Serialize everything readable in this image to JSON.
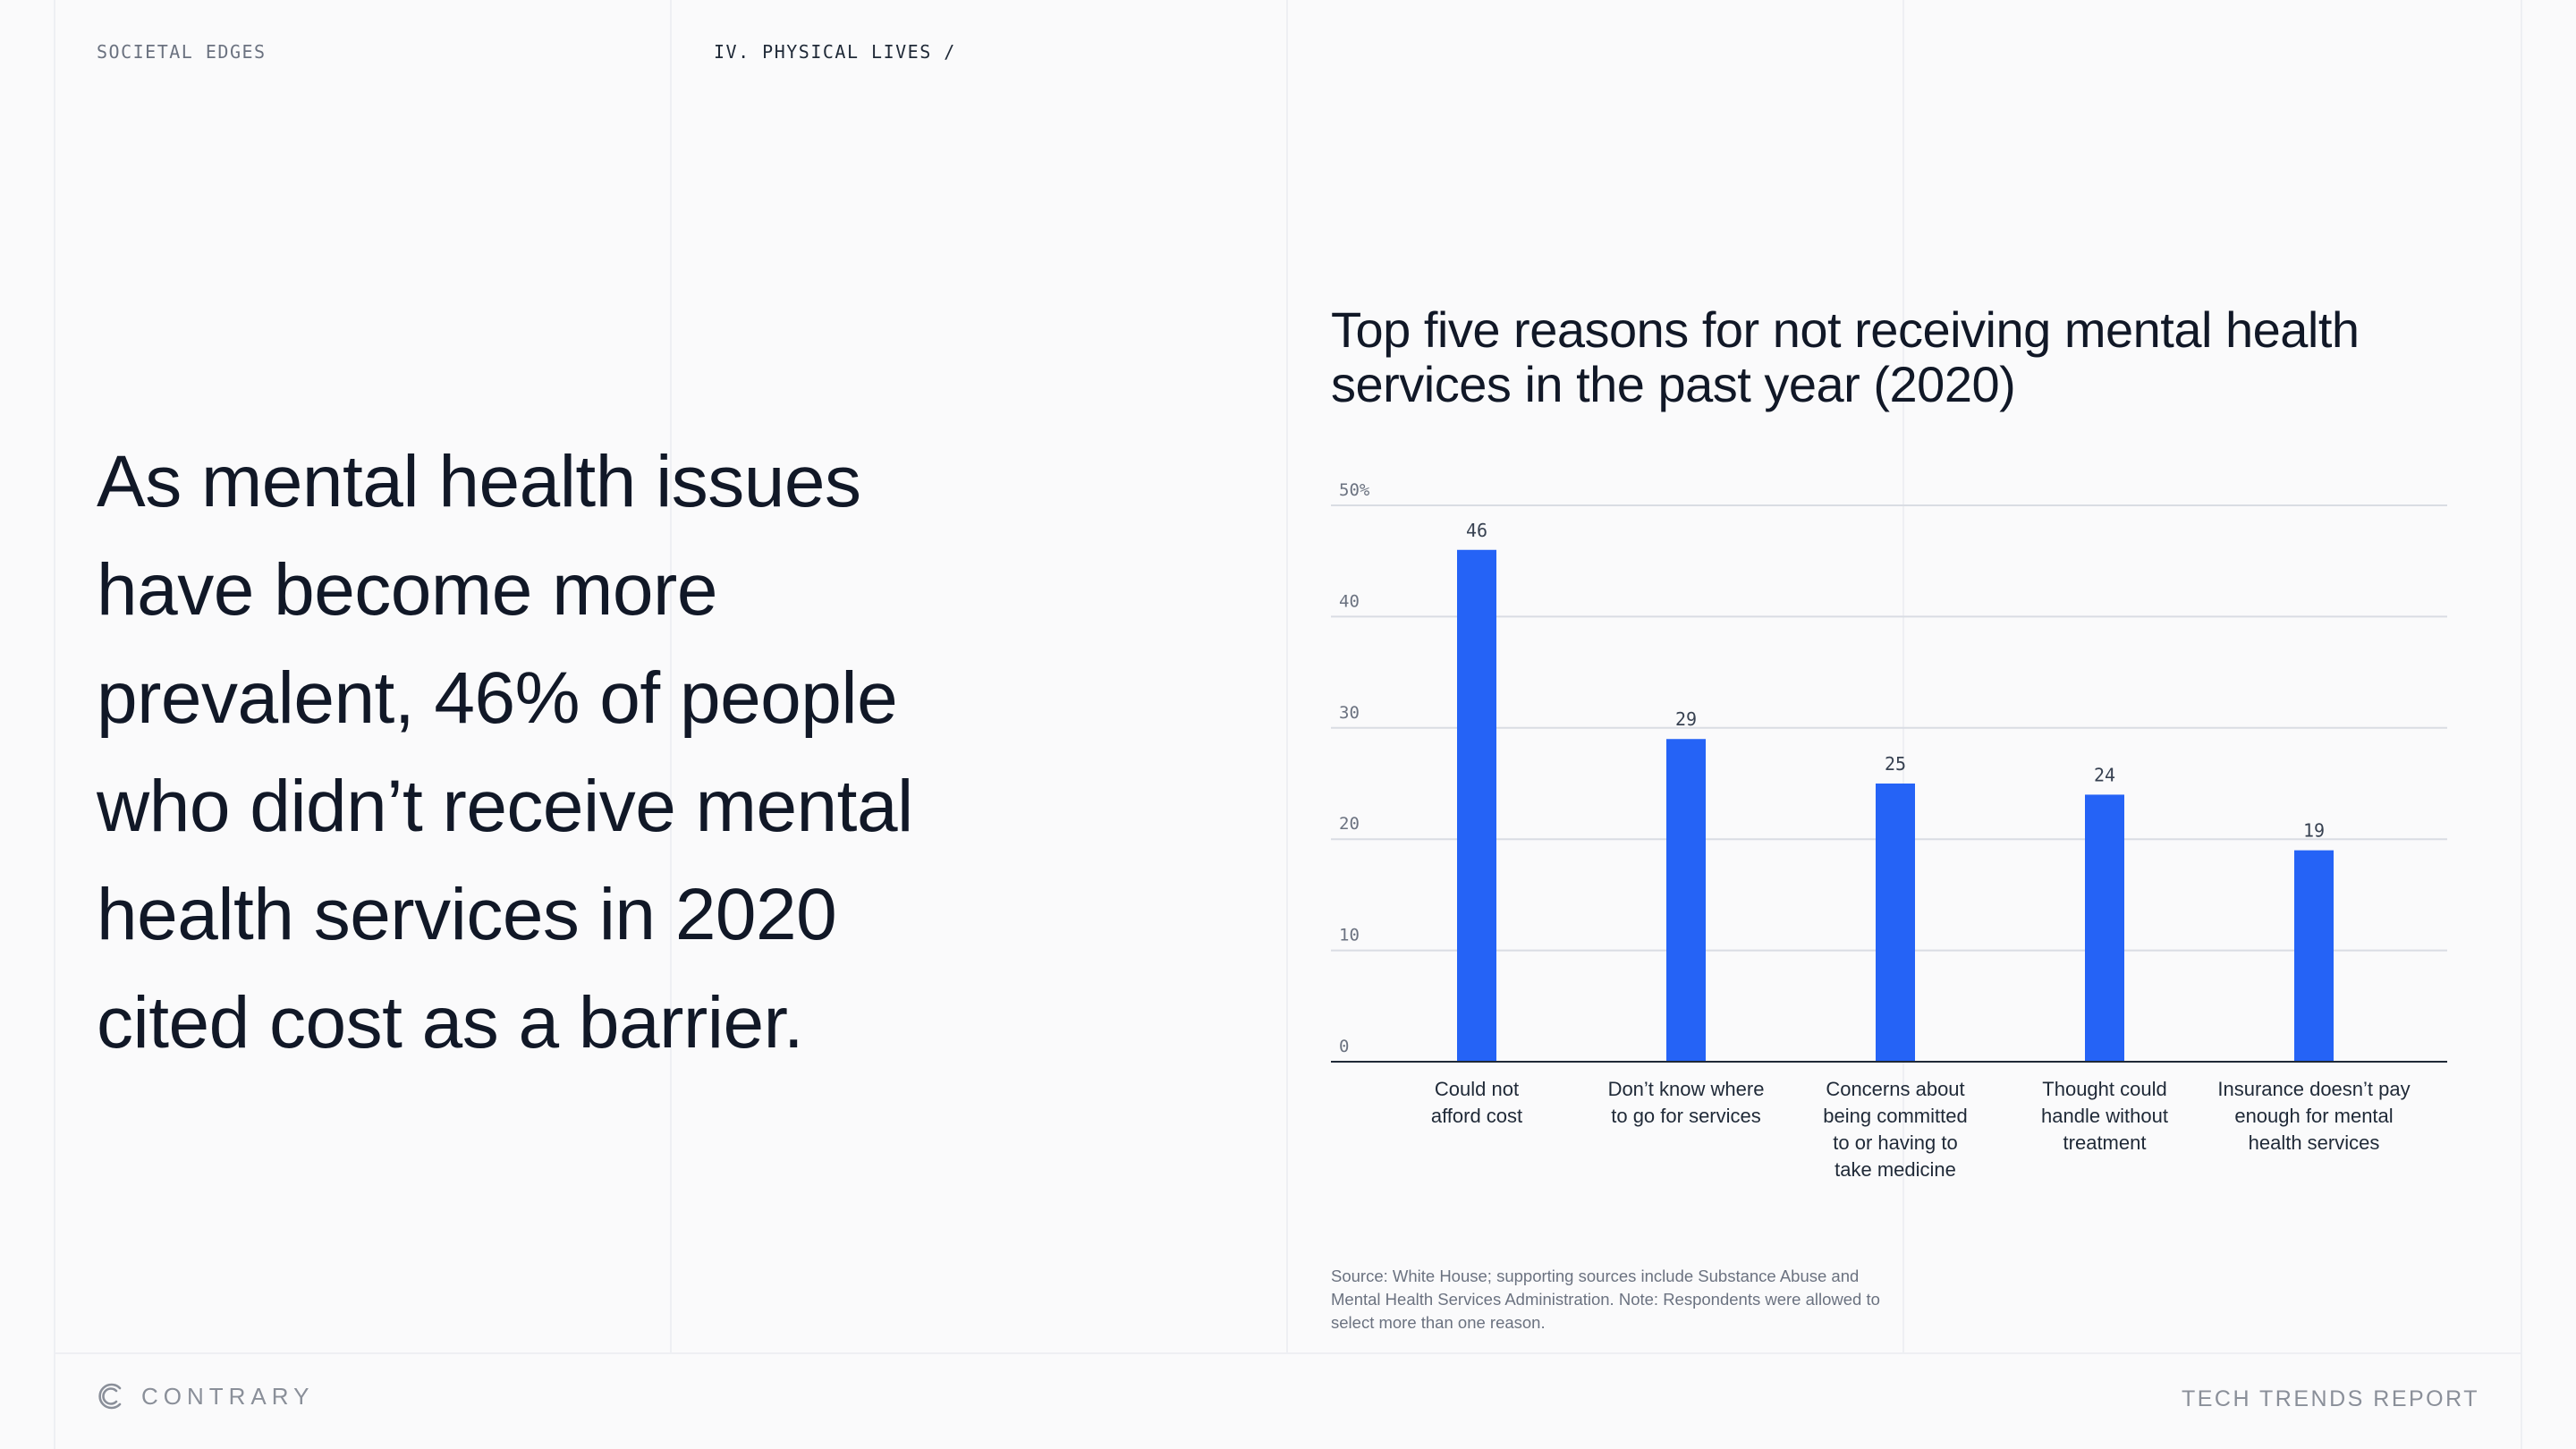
{
  "header": {
    "section": "SOCIETAL EDGES",
    "chapter": "IV. PHYSICAL LIVES /"
  },
  "headline": "As mental health issues have become more prevalent, 46% of people who didn’t receive mental health services in 2020 cited cost as a barrier.",
  "chart_data": {
    "type": "bar",
    "title": "Top five reasons for not receiving mental health services in the past year (2020)",
    "xlabel": "",
    "ylabel": "",
    "categories": [
      "Could not afford cost",
      "Don’t know where to go for services",
      "Concerns about being committed to or having to take medicine",
      "Thought could handle without treatment",
      "Insurance doesn’t pay enough for mental health services"
    ],
    "category_lines": [
      [
        "Could not",
        "afford cost"
      ],
      [
        "Don’t know where",
        "to go for services"
      ],
      [
        "Concerns about",
        "being committed",
        "to or having to",
        "take medicine"
      ],
      [
        "Thought could",
        "handle without",
        "treatment"
      ],
      [
        "Insurance doesn’t pay",
        "enough for mental",
        "health services"
      ]
    ],
    "values": [
      46,
      29,
      25,
      24,
      19
    ],
    "ylim": [
      0,
      50
    ],
    "yticks": [
      0,
      10,
      20,
      30,
      40,
      50
    ],
    "ytick_labels": [
      "0",
      "10",
      "20",
      "30",
      "40",
      "50%"
    ],
    "grid": true,
    "bar_color": "#2563f6",
    "grid_color": "#d9dce3",
    "axis_color": "#1f2937"
  },
  "source_note": "Source: White House; supporting sources include Substance Abuse and Mental Health Services Administration. Note: Respondents were allowed to select more than one reason.",
  "footer": {
    "brand": "CONTRARY",
    "report": "TECH TRENDS REPORT"
  }
}
